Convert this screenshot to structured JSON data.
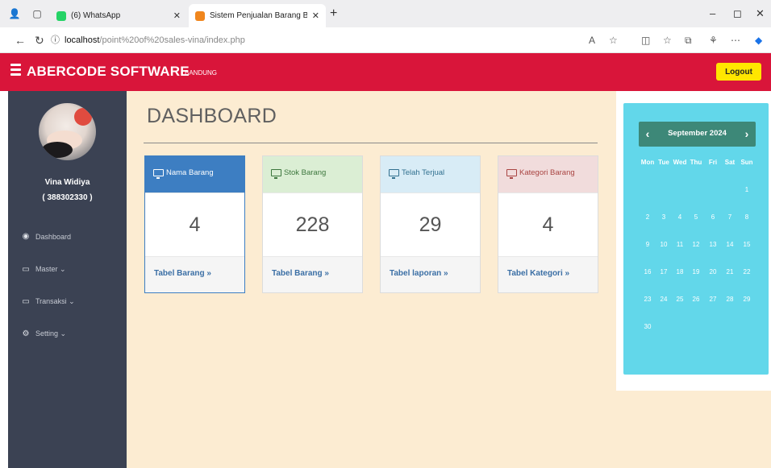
{
  "browser": {
    "tabs": [
      {
        "title": "(6) WhatsApp",
        "color": "#25d366"
      },
      {
        "title": "Sistem Penjualan Barang Berbasis",
        "color": "#f0861d"
      }
    ],
    "url_host": "localhost",
    "url_path": "/point%20of%20sales-vina/index.php"
  },
  "header": {
    "brand": "ABERCODE SOFTWARE",
    "brand_sub": "BANDUNG",
    "logout": "Logout",
    "color": "#d9153a"
  },
  "sidebar": {
    "user_name": "Vina Widiya",
    "user_id": "( 388302330 )",
    "items": [
      {
        "label": "Dashboard",
        "icon": "dashboard-icon"
      },
      {
        "label": "Master ⌄",
        "icon": "monitor-icon"
      },
      {
        "label": "Transaksi ⌄",
        "icon": "monitor-icon"
      },
      {
        "label": "Setting ⌄",
        "icon": "gear-icon"
      }
    ]
  },
  "main": {
    "title": "DASHBOARD",
    "cards": [
      {
        "header": "Nama Barang",
        "value": "4",
        "link": "Tabel Barang »"
      },
      {
        "header": "Stok Barang",
        "value": "228",
        "link": "Tabel Barang »"
      },
      {
        "header": "Telah Terjual",
        "value": "29",
        "link": "Tabel laporan »"
      },
      {
        "header": "Kategori Barang",
        "value": "4",
        "link": "Tabel Kategori »"
      }
    ]
  },
  "calendar": {
    "month": "September 2024",
    "prev": "‹",
    "next": "›",
    "weekdays": [
      "Mon",
      "Tue",
      "Wed",
      "Thu",
      "Fri",
      "Sat",
      "Sun"
    ],
    "weeks": [
      [
        "",
        "",
        "",
        "",
        "",
        "",
        "1"
      ],
      [
        "2",
        "3",
        "4",
        "5",
        "6",
        "7",
        "8"
      ],
      [
        "9",
        "10",
        "11",
        "12",
        "13",
        "14",
        "15"
      ],
      [
        "16",
        "17",
        "18",
        "19",
        "20",
        "21",
        "22"
      ],
      [
        "23",
        "24",
        "25",
        "26",
        "27",
        "28",
        "29"
      ],
      [
        "30",
        "",
        "",
        "",
        "",
        "",
        ""
      ]
    ]
  }
}
